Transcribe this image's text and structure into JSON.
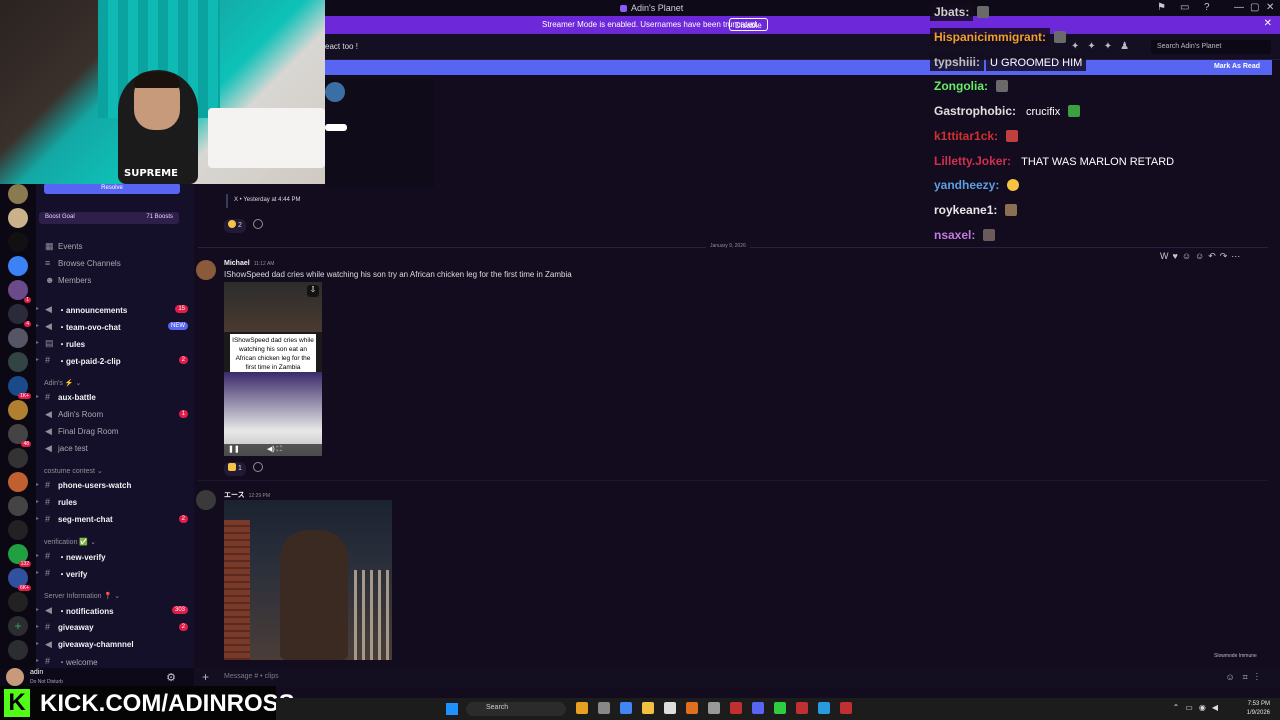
{
  "window": {
    "title": "Adin's Planet",
    "controls": [
      "—",
      "▢",
      "✕"
    ]
  },
  "banner": {
    "text": "Streamer Mode is enabled. Usernames have been truncated.",
    "button": "Disable",
    "close": "✕"
  },
  "header": {
    "channel_text": "eact too !",
    "search_placeholder": "Search Adin's Planet",
    "new_messages_action": "Mark As Read"
  },
  "sidebar": {
    "resolve_label": "Resolve",
    "boost": {
      "label": "Boost Goal",
      "count": "71 Boosts"
    },
    "top_items": [
      "Events",
      "Browse Channels",
      "Members"
    ],
    "channels": [
      {
        "name": "・announcements",
        "badge": "15",
        "icon": "megaphone",
        "bold": true
      },
      {
        "name": "・team-ovo-chat",
        "badge": "NEW",
        "icon": "megaphone",
        "bold": true
      },
      {
        "name": "・rules",
        "badge": "",
        "icon": "rules",
        "bold": true
      },
      {
        "name": "・get-paid-2-clip",
        "badge": "2",
        "icon": "hash",
        "bold": true
      }
    ],
    "cat_adin": "Adin's",
    "adin_channels": [
      {
        "name": "aux-battle",
        "badge": "",
        "icon": "hash",
        "bold": true
      },
      {
        "name": "Adin's Room",
        "badge": "1",
        "icon": "voice",
        "bold": false
      },
      {
        "name": "Final Drag Room",
        "badge": "",
        "icon": "voice",
        "bold": false
      },
      {
        "name": "jace test",
        "badge": "",
        "icon": "voice",
        "bold": false
      }
    ],
    "cat_costume": "costume contest",
    "costume_channels": [
      {
        "name": "phone-users-watch",
        "badge": "",
        "icon": "hash",
        "bold": true
      },
      {
        "name": "rules",
        "badge": "",
        "icon": "hash",
        "bold": true
      },
      {
        "name": "seg-ment-chat",
        "badge": "2",
        "icon": "hash",
        "bold": true
      }
    ],
    "cat_verification": "verification",
    "verification_channels": [
      {
        "name": "・new-verify",
        "badge": "",
        "icon": "hash",
        "bold": true
      },
      {
        "name": "・verify",
        "badge": "",
        "icon": "hash",
        "bold": true
      }
    ],
    "cat_server_info": "Server Information",
    "info_channels": [
      {
        "name": "・notifications",
        "badge": "303",
        "icon": "megaphone",
        "bold": true
      },
      {
        "name": "giveaway",
        "badge": "2",
        "icon": "hash",
        "bold": true
      },
      {
        "name": "giveaway-chamnnel",
        "badge": "",
        "icon": "megaphone",
        "bold": true
      },
      {
        "name": "・welcome",
        "badge": "",
        "icon": "hash",
        "bold": false
      }
    ]
  },
  "rail_badges": [
    "1",
    "4",
    "1K+",
    "48",
    "132",
    "6K+"
  ],
  "user": {
    "name": "adin",
    "status": "Do Not Disturb"
  },
  "kick": {
    "logo": "K",
    "text": "KICK.COM/ADINROSS"
  },
  "webcam": {
    "shirt_text": "SUPREME"
  },
  "messages": {
    "x_line": "X • Yesterday at 4:44 PM",
    "prev_react_count": "2",
    "date_divider": "January 9, 2026",
    "msg1": {
      "author": "Michael",
      "time": "11:12 AM",
      "text": "IShowSpeed dad cries while watching his son try an African chicken leg for the first time in Zambia",
      "caption": "IShowSpeed dad cries while watching his son eat an African chicken leg for the first time in Zambia",
      "react_count": "1"
    },
    "msg2": {
      "author": "エース",
      "time": "12:29 PM"
    }
  },
  "slowmode": "Slowmode Immune",
  "composer": {
    "placeholder": "Message # • clips"
  },
  "taskbar": {
    "search": "Search",
    "time": "7:53 PM",
    "date": "1/9/2026"
  },
  "chat_overlay": [
    {
      "user": "Jbats:",
      "color": "#d0d0d0",
      "message": "",
      "emote": true
    },
    {
      "user": "Hispanicimmigrant:",
      "color": "#f0a030",
      "message": "",
      "emote": true
    },
    {
      "user": "typshiii:",
      "color": "#c0c0c0",
      "message": "U GROOMED HIM",
      "emote": false
    },
    {
      "user": "Zongolia:",
      "color": "#66ee66",
      "message": "",
      "emote": true
    },
    {
      "user": "Gastrophobic:",
      "color": "#e0e0e0",
      "message": "crucifix",
      "emote": true
    },
    {
      "user": "k1ttitar1ck:",
      "color": "#d03030",
      "message": "",
      "emote": true
    },
    {
      "user": "Lilletty.Joker:",
      "color": "#d03050",
      "message": "THAT WAS MARLON RETARD",
      "emote": false
    },
    {
      "user": "yandheezy:",
      "color": "#5aa0e0",
      "message": "",
      "emote": true
    },
    {
      "user": "roykeane1:",
      "color": "#e8e8e8",
      "message": "",
      "emote": true
    },
    {
      "user": "nsaxel:",
      "color": "#c07ae0",
      "message": "",
      "emote": true
    }
  ],
  "colors": {
    "accent": "#5865f2",
    "banner": "#6d28d9",
    "kick_green": "#53fc18",
    "badge_red": "#e11d48"
  }
}
